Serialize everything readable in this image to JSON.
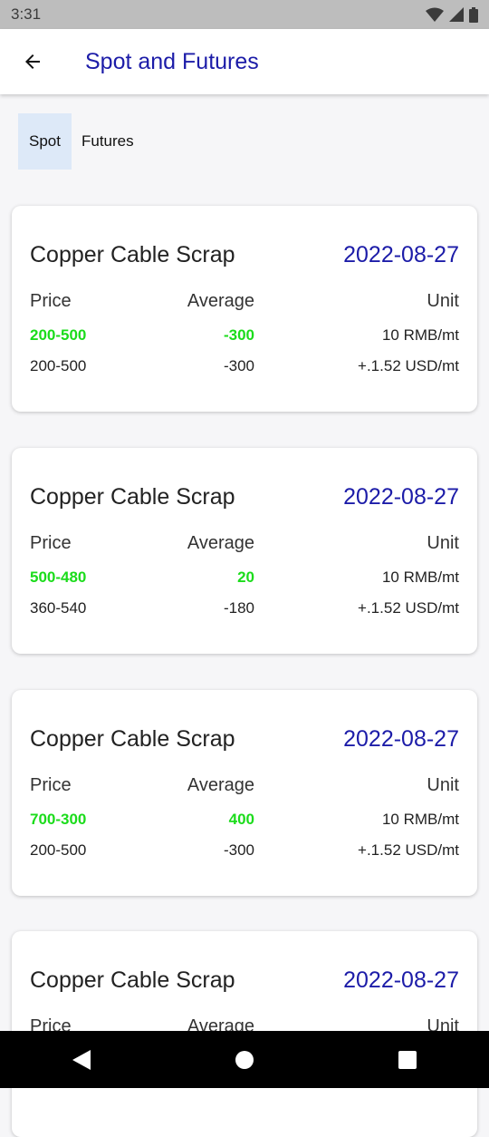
{
  "status_bar": {
    "time": "3:31",
    "icons": [
      "wifi-icon",
      "signal-icon",
      "battery-icon"
    ]
  },
  "app_bar": {
    "title": "Spot and Futures",
    "back_icon": "arrow-left-icon"
  },
  "tabs": [
    {
      "label": "Spot",
      "active": true
    },
    {
      "label": "Futures",
      "active": false
    }
  ],
  "cards": [
    {
      "title": "Copper Cable Scrap",
      "date": "2022-08-27",
      "headers": {
        "price": "Price",
        "average": "Average",
        "unit": "Unit"
      },
      "primary": {
        "price": "200-500",
        "average": "-300",
        "unit": "10 RMB/mt"
      },
      "secondary": {
        "price": "200-500",
        "average": "-300",
        "unit": "+.1.52 USD/mt"
      }
    },
    {
      "title": "Copper Cable Scrap",
      "date": "2022-08-27",
      "headers": {
        "price": "Price",
        "average": "Average",
        "unit": "Unit"
      },
      "primary": {
        "price": "500-480",
        "average": "20",
        "unit": "10 RMB/mt"
      },
      "secondary": {
        "price": "360-540",
        "average": "-180",
        "unit": "+.1.52 USD/mt"
      }
    },
    {
      "title": "Copper Cable Scrap",
      "date": "2022-08-27",
      "headers": {
        "price": "Price",
        "average": "Average",
        "unit": "Unit"
      },
      "primary": {
        "price": "700-300",
        "average": "400",
        "unit": "10 RMB/mt"
      },
      "secondary": {
        "price": "200-500",
        "average": "-300",
        "unit": "+.1.52 USD/mt"
      }
    },
    {
      "title": "Copper Cable Scrap",
      "date": "2022-08-27",
      "headers": {
        "price": "Price",
        "average": "Average",
        "unit": "Unit"
      }
    }
  ],
  "colors": {
    "accent": "#1c1ca8",
    "positive": "#1bdc1b",
    "tab_active_bg": "#dde9f8"
  },
  "nav_bar": {
    "icons": [
      "back-triangle-icon",
      "home-circle-icon",
      "recents-square-icon"
    ]
  }
}
